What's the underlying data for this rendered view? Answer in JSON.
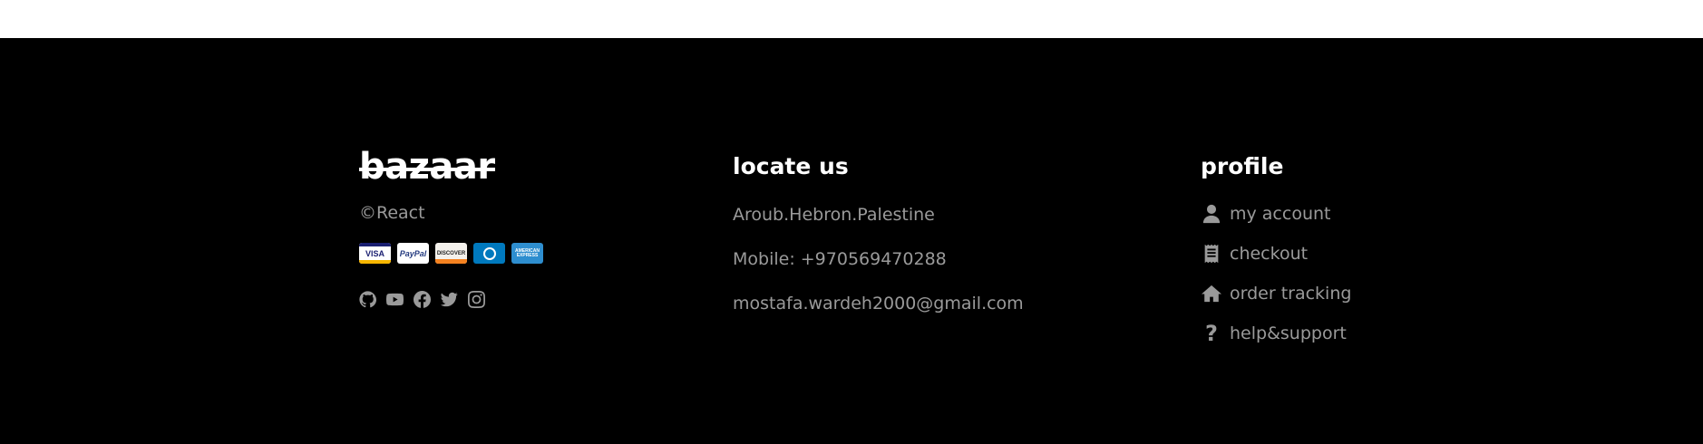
{
  "brand": {
    "logo": "bazaar",
    "copyright": "©React",
    "payment_methods": [
      {
        "name": "visa",
        "label": "VISA"
      },
      {
        "name": "paypal",
        "label": "PayPal"
      },
      {
        "name": "discover",
        "label": "DISCOVER"
      },
      {
        "name": "diners",
        "label": ""
      },
      {
        "name": "amex",
        "label": "AMERICAN EXPRESS"
      }
    ],
    "social_icons": [
      "github-icon",
      "youtube-icon",
      "facebook-icon",
      "twitter-icon",
      "instagram-icon"
    ]
  },
  "locate": {
    "heading": "locate us",
    "address": "Aroub.Hebron.Palestine",
    "mobile": "Mobile: +970569470288",
    "email": "mostafa.wardeh2000@gmail.com"
  },
  "profile": {
    "heading": "profile",
    "items": [
      {
        "label": "my account",
        "icon": "user-icon"
      },
      {
        "label": "checkout",
        "icon": "receipt-icon"
      },
      {
        "label": "order tracking",
        "icon": "home-icon"
      },
      {
        "label": "help&support",
        "icon": "question-icon"
      }
    ]
  },
  "colors": {
    "footer_bg": "#000000",
    "heading": "#ffffff",
    "muted_text": "#9a9a9a"
  }
}
